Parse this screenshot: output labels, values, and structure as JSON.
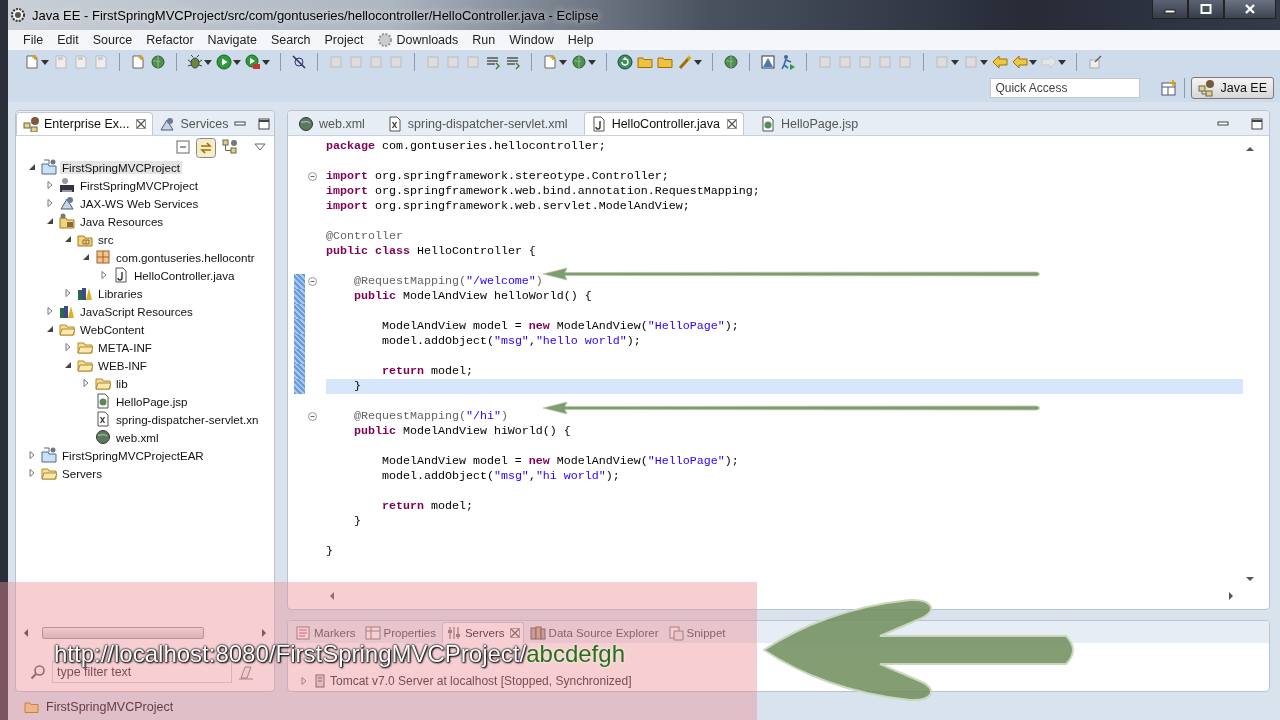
{
  "window": {
    "title": "Java EE - FirstSpringMVCProject/src/com/gontuseries/hellocontroller/HelloController.java - Eclipse"
  },
  "menu": [
    {
      "label": "File"
    },
    {
      "label": "Edit"
    },
    {
      "label": "Source"
    },
    {
      "label": "Refactor"
    },
    {
      "label": "Navigate"
    },
    {
      "label": "Search"
    },
    {
      "label": "Project"
    },
    {
      "label": "Downloads",
      "kind": "icon"
    },
    {
      "label": "Run"
    },
    {
      "label": "Window"
    },
    {
      "label": "Help"
    }
  ],
  "quick_access": {
    "placeholder": "Quick Access"
  },
  "perspective": {
    "label": "Java EE",
    "selected": true
  },
  "explorer": {
    "tabs": [
      {
        "label": "Enterprise Ex...",
        "kind": "explorer",
        "selected": true
      },
      {
        "label": "Services",
        "kind": "services",
        "selected": false
      }
    ],
    "tree": [
      {
        "label": "FirstSpringMVCProject",
        "kind": "project",
        "has_children": true,
        "expanded": true,
        "selected": true,
        "children": [
          {
            "label": "FirstSpringMVCProject",
            "kind": "facet",
            "has_children": true,
            "expanded": false,
            "selected": false
          },
          {
            "label": "JAX-WS Web Services",
            "kind": "services",
            "has_children": true,
            "expanded": false,
            "selected": false
          },
          {
            "label": "Java Resources",
            "kind": "resources",
            "has_children": true,
            "expanded": true,
            "selected": false,
            "children": [
              {
                "label": "src",
                "kind": "source",
                "has_children": true,
                "expanded": true,
                "selected": false,
                "children": [
                  {
                    "label": "com.gontuseries.hellocontr",
                    "kind": "package",
                    "has_children": true,
                    "expanded": true,
                    "selected": false,
                    "children": [
                      {
                        "label": "HelloController.java",
                        "kind": "java",
                        "has_children": true,
                        "expanded": false,
                        "selected": false
                      }
                    ]
                  }
                ]
              },
              {
                "label": "Libraries",
                "kind": "library",
                "has_children": true,
                "expanded": false,
                "selected": false
              }
            ]
          },
          {
            "label": "JavaScript Resources",
            "kind": "library",
            "has_children": true,
            "expanded": false,
            "selected": false
          },
          {
            "label": "WebContent",
            "kind": "folder",
            "has_children": true,
            "expanded": true,
            "selected": false,
            "children": [
              {
                "label": "META-INF",
                "kind": "folder",
                "has_children": true,
                "expanded": false,
                "selected": false
              },
              {
                "label": "WEB-INF",
                "kind": "folder",
                "has_children": true,
                "expanded": true,
                "selected": false,
                "children": [
                  {
                    "label": "lib",
                    "kind": "folder",
                    "has_children": true,
                    "expanded": false,
                    "selected": false
                  },
                  {
                    "label": "HelloPage.jsp",
                    "kind": "jsp",
                    "has_children": false,
                    "selected": false
                  },
                  {
                    "label": "spring-dispatcher-servlet.xn",
                    "kind": "xml",
                    "has_children": false,
                    "selected": false
                  },
                  {
                    "label": "web.xml",
                    "kind": "web",
                    "has_children": false,
                    "selected": false
                  }
                ]
              }
            ]
          }
        ]
      },
      {
        "label": "FirstSpringMVCProjectEAR",
        "kind": "project",
        "has_children": true,
        "expanded": false,
        "selected": false
      },
      {
        "label": "Servers",
        "kind": "folder",
        "has_children": true,
        "expanded": false,
        "selected": false
      }
    ],
    "filter": {
      "placeholder": "type filter text"
    }
  },
  "editor": {
    "tabs": [
      {
        "label": "web.xml",
        "kind": "web",
        "selected": false
      },
      {
        "label": "spring-dispatcher-servlet.xml",
        "kind": "xml",
        "selected": false
      },
      {
        "label": "HelloController.java",
        "kind": "java",
        "selected": true
      },
      {
        "label": "HelloPage.jsp",
        "kind": "jsp",
        "selected": false
      }
    ],
    "lines": [
      {
        "kind": "code",
        "fold": false,
        "changed": false,
        "current": false,
        "segments": [
          {
            "kind": "keyword",
            "text": "package"
          },
          {
            "kind": "plain",
            "text": " com.gontuseries.hellocontroller;"
          }
        ]
      },
      {
        "kind": "blank",
        "fold": false,
        "changed": false,
        "current": false
      },
      {
        "kind": "code",
        "fold": true,
        "changed": false,
        "current": false,
        "segments": [
          {
            "kind": "keyword",
            "text": "import"
          },
          {
            "kind": "plain",
            "text": " org.springframework.stereotype.Controller;"
          }
        ]
      },
      {
        "kind": "code",
        "fold": false,
        "changed": false,
        "current": false,
        "segments": [
          {
            "kind": "keyword",
            "text": "import"
          },
          {
            "kind": "plain",
            "text": " org.springframework.web.bind.annotation.RequestMapping;"
          }
        ]
      },
      {
        "kind": "code",
        "fold": false,
        "changed": false,
        "current": false,
        "segments": [
          {
            "kind": "keyword",
            "text": "import"
          },
          {
            "kind": "plain",
            "text": " org.springframework.web.servlet.ModelAndView;"
          }
        ]
      },
      {
        "kind": "blank",
        "fold": false,
        "changed": false,
        "current": false
      },
      {
        "kind": "code",
        "fold": false,
        "changed": false,
        "current": false,
        "segments": [
          {
            "kind": "annotation",
            "text": "@Controller"
          }
        ]
      },
      {
        "kind": "code",
        "fold": false,
        "changed": false,
        "current": false,
        "segments": [
          {
            "kind": "keyword",
            "text": "public class"
          },
          {
            "kind": "plain",
            "text": " HelloController {"
          }
        ]
      },
      {
        "kind": "blank",
        "fold": false,
        "changed": false,
        "current": false
      },
      {
        "kind": "code",
        "fold": true,
        "changed": true,
        "current": false,
        "segments": [
          {
            "kind": "annotation",
            "text": "    @RequestMapping("
          },
          {
            "kind": "string",
            "text": "\"/welcome\""
          },
          {
            "kind": "annotation",
            "text": ")"
          }
        ]
      },
      {
        "kind": "code",
        "fold": false,
        "changed": true,
        "current": false,
        "segments": [
          {
            "kind": "keyword",
            "text": "    public"
          },
          {
            "kind": "plain",
            "text": " ModelAndView helloWorld() {"
          }
        ]
      },
      {
        "kind": "blank",
        "fold": false,
        "changed": true,
        "current": false
      },
      {
        "kind": "code",
        "fold": false,
        "changed": true,
        "current": false,
        "segments": [
          {
            "kind": "plain",
            "text": "        ModelAndView model = "
          },
          {
            "kind": "keyword",
            "text": "new"
          },
          {
            "kind": "plain",
            "text": " ModelAndView("
          },
          {
            "kind": "string",
            "text": "\"HelloPage\""
          },
          {
            "kind": "plain",
            "text": ");"
          }
        ]
      },
      {
        "kind": "code",
        "fold": false,
        "changed": true,
        "current": false,
        "segments": [
          {
            "kind": "plain",
            "text": "        model.addObject("
          },
          {
            "kind": "string",
            "text": "\"msg\""
          },
          {
            "kind": "plain",
            "text": ","
          },
          {
            "kind": "string",
            "text": "\"hello world\""
          },
          {
            "kind": "plain",
            "text": ");"
          }
        ]
      },
      {
        "kind": "blank",
        "fold": false,
        "changed": true,
        "current": false
      },
      {
        "kind": "code",
        "fold": false,
        "changed": true,
        "current": false,
        "segments": [
          {
            "kind": "keyword",
            "text": "        return"
          },
          {
            "kind": "plain",
            "text": " model;"
          }
        ]
      },
      {
        "kind": "code",
        "fold": false,
        "changed": true,
        "current": true,
        "segments": [
          {
            "kind": "plain",
            "text": "    }"
          }
        ]
      },
      {
        "kind": "blank",
        "fold": false,
        "changed": false,
        "current": false
      },
      {
        "kind": "code",
        "fold": true,
        "changed": false,
        "current": false,
        "segments": [
          {
            "kind": "annotation",
            "text": "    @RequestMapping("
          },
          {
            "kind": "string",
            "text": "\"/hi\""
          },
          {
            "kind": "annotation",
            "text": ")"
          }
        ]
      },
      {
        "kind": "code",
        "fold": false,
        "changed": false,
        "current": false,
        "segments": [
          {
            "kind": "keyword",
            "text": "    public"
          },
          {
            "kind": "plain",
            "text": " ModelAndView hiWorld() {"
          }
        ]
      },
      {
        "kind": "blank",
        "fold": false,
        "changed": false,
        "current": false
      },
      {
        "kind": "code",
        "fold": false,
        "changed": false,
        "current": false,
        "segments": [
          {
            "kind": "plain",
            "text": "        ModelAndView model = "
          },
          {
            "kind": "keyword",
            "text": "new"
          },
          {
            "kind": "plain",
            "text": " ModelAndView("
          },
          {
            "kind": "string",
            "text": "\"HelloPage\""
          },
          {
            "kind": "plain",
            "text": ");"
          }
        ]
      },
      {
        "kind": "code",
        "fold": false,
        "changed": false,
        "current": false,
        "segments": [
          {
            "kind": "plain",
            "text": "        model.addObject("
          },
          {
            "kind": "string",
            "text": "\"msg\""
          },
          {
            "kind": "plain",
            "text": ","
          },
          {
            "kind": "string",
            "text": "\"hi world\""
          },
          {
            "kind": "plain",
            "text": ");"
          }
        ]
      },
      {
        "kind": "blank",
        "fold": false,
        "changed": false,
        "current": false
      },
      {
        "kind": "code",
        "fold": false,
        "changed": false,
        "current": false,
        "segments": [
          {
            "kind": "keyword",
            "text": "        return"
          },
          {
            "kind": "plain",
            "text": " model;"
          }
        ]
      },
      {
        "kind": "code",
        "fold": false,
        "changed": false,
        "current": false,
        "segments": [
          {
            "kind": "plain",
            "text": "    }"
          }
        ]
      },
      {
        "kind": "blank",
        "fold": false,
        "changed": false,
        "current": false
      },
      {
        "kind": "code",
        "fold": false,
        "changed": false,
        "current": false,
        "segments": [
          {
            "kind": "plain",
            "text": "}"
          }
        ]
      }
    ]
  },
  "bottom_panel": {
    "tabs": [
      {
        "label": "Markers",
        "kind": "markers",
        "selected": false
      },
      {
        "label": "Properties",
        "kind": "properties",
        "selected": false
      },
      {
        "label": "Servers",
        "kind": "servers",
        "selected": true
      },
      {
        "label": "Data Source Explorer",
        "kind": "database",
        "selected": false
      },
      {
        "label": "Snippet",
        "kind": "snippets",
        "selected": false
      }
    ],
    "rows": [
      {
        "label": "Tomcat v7.0 Server at localhost  [Stopped, Synchronized]",
        "expanded": false
      }
    ]
  },
  "status_bar": {
    "text": "FirstSpringMVCProject"
  },
  "overlay": {
    "url": "http://localhost:8080/FirstSpringMVCProject/",
    "url_highlight": "abcdefgh"
  }
}
